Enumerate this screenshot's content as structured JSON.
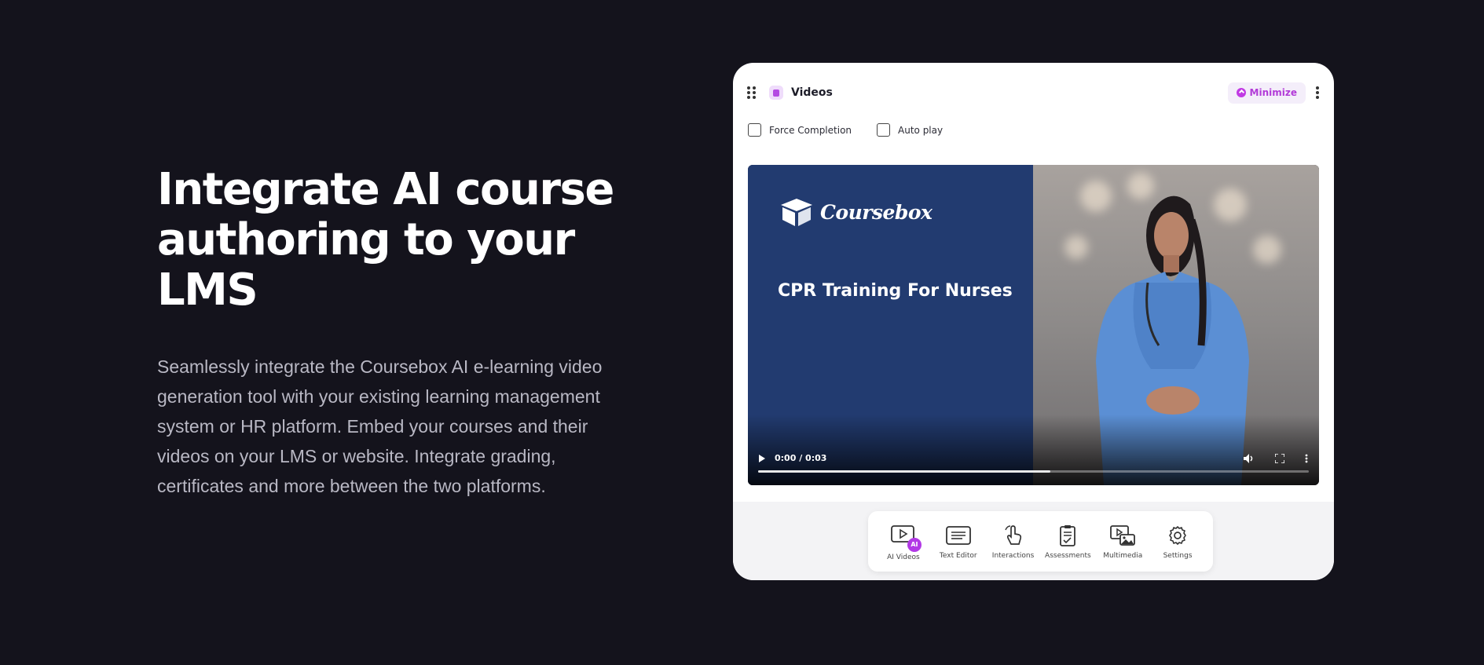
{
  "hero": {
    "title_line1": "Integrate AI course",
    "title_line2": "authoring to your LMS",
    "description": "Seamlessly integrate the Coursebox AI e-learning video generation tool with your existing learning management system or HR platform. Embed your courses and their videos on your LMS or website. Integrate grading, certificates and more between the two platforms."
  },
  "panel": {
    "title": "Videos",
    "minimize_label": "Minimize",
    "options": [
      {
        "label": "Force Completion",
        "checked": false
      },
      {
        "label": "Auto play",
        "checked": false
      }
    ],
    "video": {
      "brand": "Coursebox",
      "title": "CPR Training For Nurses",
      "time": "0:00 / 0:03",
      "progress": 0.53
    },
    "toolbar": [
      {
        "label": "AI Videos",
        "icon": "ai-video-icon",
        "badge": "AI"
      },
      {
        "label": "Text Editor",
        "icon": "text-editor-icon"
      },
      {
        "label": "Interactions",
        "icon": "pointer-hand-icon"
      },
      {
        "label": "Assessments",
        "icon": "clipboard-check-icon"
      },
      {
        "label": "Multimedia",
        "icon": "multimedia-icon"
      },
      {
        "label": "Settings",
        "icon": "gear-icon"
      }
    ]
  },
  "colors": {
    "background": "#14131c",
    "accent": "#b239e6",
    "slide_blue": "#223b70"
  }
}
